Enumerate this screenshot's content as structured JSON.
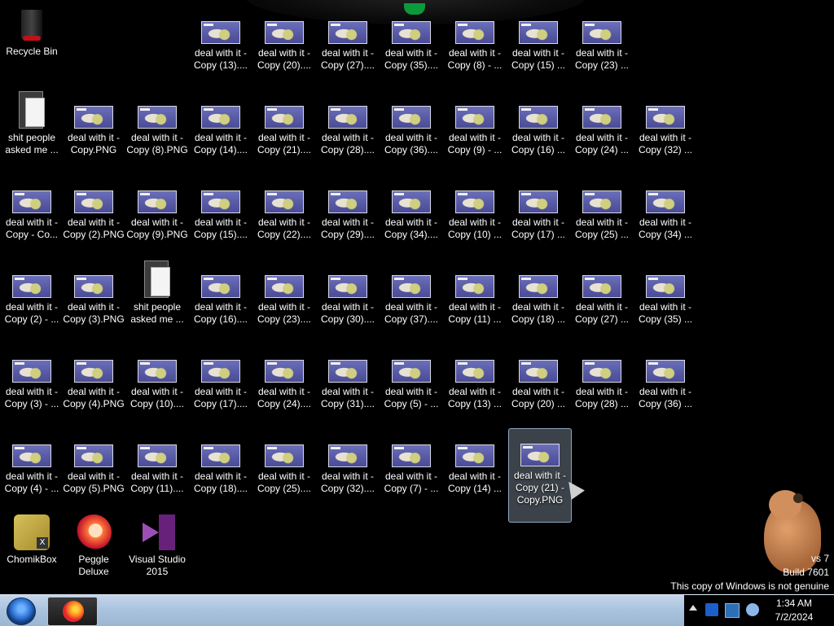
{
  "desktop": {
    "recycle_bin": "Recycle Bin",
    "icons": [
      [
        "",
        "deal with it -\nCopy (13)....",
        "deal with it -\nCopy (20)....",
        "deal with it -\nCopy (27)....",
        "deal with it -\nCopy (35)....",
        "deal with it -\nCopy (8) - ...",
        "deal with it -\nCopy (15) ...",
        "deal with it -\nCopy (23) ...",
        ""
      ],
      [
        "shit people\nasked me ...",
        "deal with it -\nCopy.PNG",
        "deal with it -\nCopy (8).PNG",
        "deal with it -\nCopy (14)....",
        "deal with it -\nCopy (21)....",
        "deal with it -\nCopy (28)....",
        "deal with it -\nCopy (36)....",
        "deal with it -\nCopy (9) - ...",
        "deal with it -\nCopy (16) ...",
        "deal with it -\nCopy (24) ...",
        "deal with it -\nCopy (32) ..."
      ],
      [
        "deal with it -\nCopy - Co...",
        "deal with it -\nCopy (2).PNG",
        "deal with it -\nCopy (9).PNG",
        "deal with it -\nCopy (15)....",
        "deal with it -\nCopy (22)....",
        "deal with it -\nCopy (29)....",
        "deal with it -\nCopy (34)....",
        "deal with it -\nCopy (10) ...",
        "deal with it -\nCopy (17) ...",
        "deal with it -\nCopy (25) ...",
        "deal with it -\nCopy (34) ..."
      ],
      [
        "deal with it -\nCopy (2) - ...",
        "deal with it -\nCopy (3).PNG",
        "shit people\nasked me ...",
        "deal with it -\nCopy (16)....",
        "deal with it -\nCopy (23)....",
        "deal with it -\nCopy (30)....",
        "deal with it -\nCopy (37)....",
        "deal with it -\nCopy (11) ...",
        "deal with it -\nCopy (18) ...",
        "deal with it -\nCopy (27) ...",
        "deal with it -\nCopy (35) ..."
      ],
      [
        "deal with it -\nCopy (3) - ...",
        "deal with it -\nCopy (4).PNG",
        "deal with it -\nCopy (10)....",
        "deal with it -\nCopy (17)....",
        "deal with it -\nCopy (24)....",
        "deal with it -\nCopy (31)....",
        "deal with it -\nCopy (5) - ...",
        "deal with it -\nCopy (13) ...",
        "deal with it -\nCopy (20) ...",
        "deal with it -\nCopy (28) ...",
        "deal with it -\nCopy (36) ..."
      ],
      [
        "deal with it -\nCopy (4) - ...",
        "deal with it -\nCopy (5).PNG",
        "deal with it -\nCopy (11)....",
        "deal with it -\nCopy (18)....",
        "deal with it -\nCopy (25)....",
        "deal with it -\nCopy (32)....",
        "deal with it -\nCopy (7) - ...",
        "deal with it -\nCopy (14) ...",
        "deal with it -\nCopy (21) -\nCopy.PNG"
      ]
    ],
    "apps": [
      "ChomikBox",
      "Peggle Deluxe",
      "Visual Studio\n2015"
    ],
    "watermark": {
      "line1": "vs 7",
      "line2": "Build 7601",
      "line3": "This copy of Windows is not genuine"
    }
  },
  "taskbar": {
    "clock_time": "1:34 AM",
    "clock_date": "7/2/2024"
  }
}
